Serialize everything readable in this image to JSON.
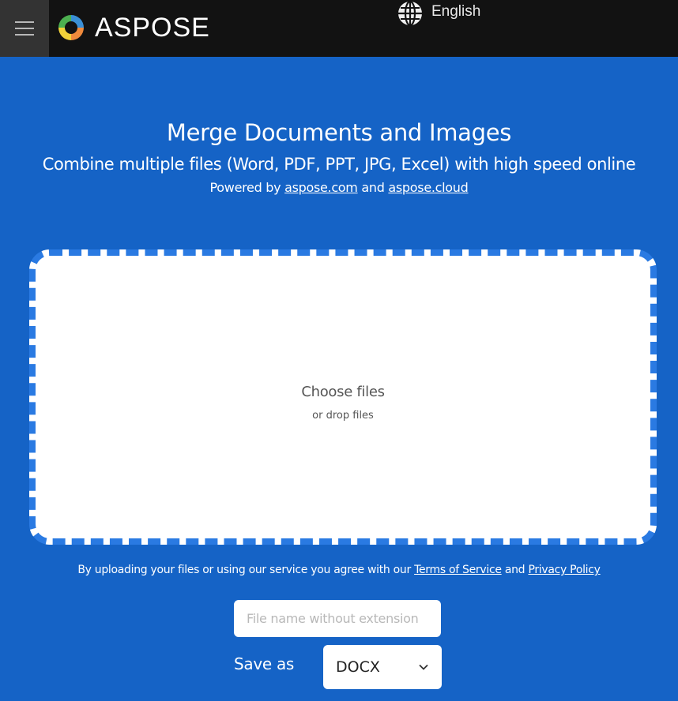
{
  "header": {
    "brand": "ASPOSE",
    "language": "English",
    "icons": {
      "menu": "hamburger-icon",
      "logo": "aspose-swirl-logo",
      "language": "globe-icon"
    }
  },
  "hero": {
    "title": "Merge Documents and Images",
    "subtitle": "Combine multiple files (Word, PDF, PPT, JPG, Excel) with high speed online",
    "powered_prefix": "Powered by",
    "powered_link1": "aspose.com",
    "powered_and": "and",
    "powered_link2": "aspose.cloud"
  },
  "dropzone": {
    "choose_label": "Choose files",
    "drop_label": "or drop files"
  },
  "terms": {
    "prefix": "By uploading your files or using our service you agree with our",
    "terms_link": "Terms of Service",
    "and": "and",
    "privacy_link": "Privacy Policy"
  },
  "form": {
    "filename_placeholder": "File name without extension",
    "filename_value": "",
    "save_as_label": "Save as",
    "format_selected": "DOCX"
  },
  "colors": {
    "header_bg": "#121212",
    "page_bg": "#1563c6",
    "dash_border": "#2a7ae2"
  }
}
